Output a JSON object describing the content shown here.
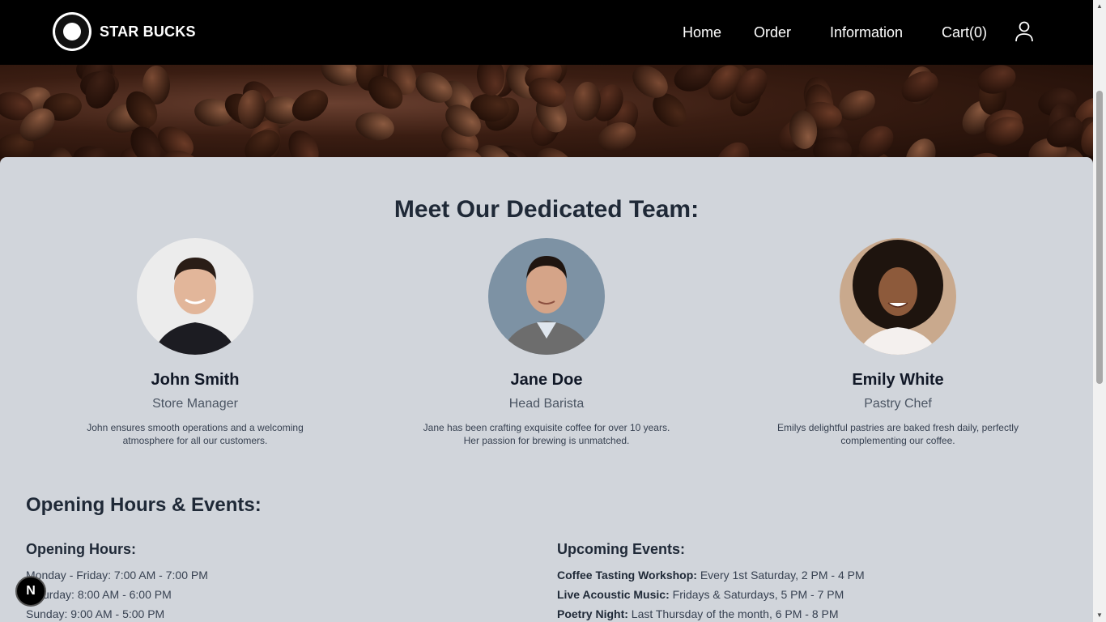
{
  "nav": {
    "brand": "STAR BUCKS",
    "links": [
      "Home",
      "Order",
      "Information",
      "Cart(0)"
    ]
  },
  "team": {
    "title": "Meet Our Dedicated Team:",
    "members": [
      {
        "name": "John Smith",
        "role": "Store Manager",
        "desc": "John ensures smooth operations and a welcoming atmosphere for all our customers."
      },
      {
        "name": "Jane Doe",
        "role": "Head Barista",
        "desc": "Jane has been crafting exquisite coffee for over 10 years. Her passion for brewing is unmatched."
      },
      {
        "name": "Emily White",
        "role": "Pastry Chef",
        "desc": "Emilys delightful pastries are baked fresh daily, perfectly complementing our coffee."
      }
    ]
  },
  "events": {
    "title": "Opening Hours & Events:",
    "hours_title": "Opening Hours:",
    "hours": [
      "Monday - Friday: 7:00 AM - 7:00 PM",
      "Saturday: 8:00 AM - 6:00 PM",
      "Sunday: 9:00 AM - 5:00 PM"
    ],
    "upcoming_title": "Upcoming Events:",
    "upcoming": [
      {
        "name": "Coffee Tasting Workshop:",
        "when": "Every 1st Saturday, 2 PM - 4 PM"
      },
      {
        "name": "Live Acoustic Music:",
        "when": "Fridays & Saturdays, 5 PM - 7 PM"
      },
      {
        "name": "Poetry Night:",
        "when": "Last Thursday of the month, 6 PM - 8 PM"
      }
    ]
  },
  "dev_badge": "N",
  "colors": {
    "nav_bg": "#000000",
    "content_bg": "#d1d5db",
    "heading": "#1f2937"
  }
}
